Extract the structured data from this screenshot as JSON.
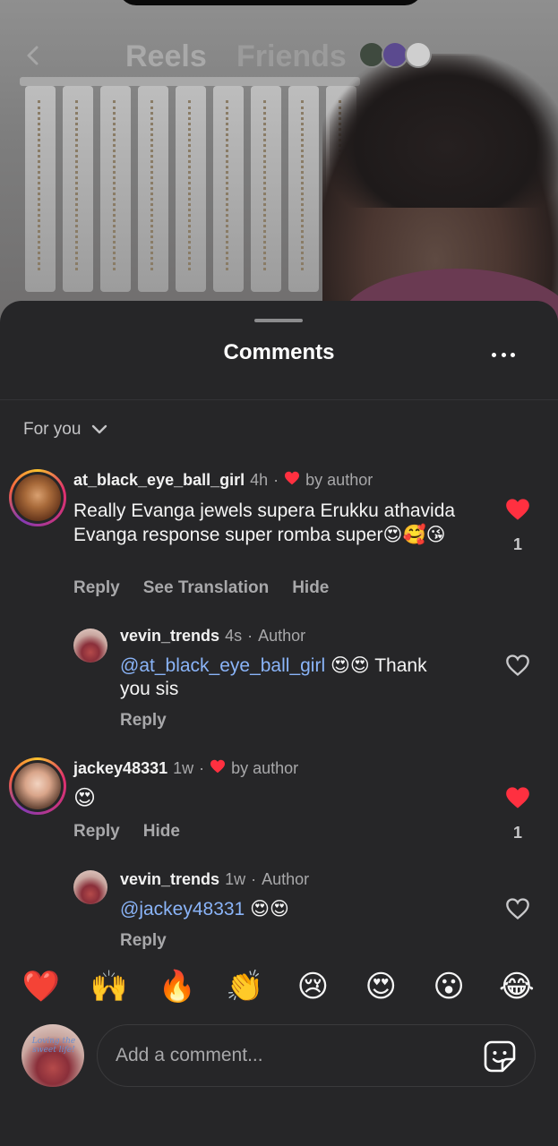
{
  "top_nav": {
    "tab_reels": "Reels",
    "tab_friends": "Friends"
  },
  "sheet": {
    "title": "Comments",
    "filter_label": "For you"
  },
  "comments": [
    {
      "username": "at_black_eye_ball_girl",
      "time": "4h",
      "badge": "by author",
      "text": "Really Evanga jewels supera Erukku athavida Evanga response super romba super",
      "emojis": "😍🥰😘",
      "actions": [
        "Reply",
        "See Translation",
        "Hide"
      ],
      "likes": "1",
      "liked": true,
      "reply": {
        "username": "vevin_trends",
        "time": "4s",
        "role": "Author",
        "mention": "@at_black_eye_ball_girl",
        "emojis": "😍😍",
        "text_after": "Thank",
        "text_line2": "you sis",
        "action": "Reply",
        "liked": false
      }
    },
    {
      "username": "jackey48331",
      "time": "1w",
      "badge": "by author",
      "emojis": "😍",
      "actions": [
        "Reply",
        "Hide"
      ],
      "likes": "1",
      "liked": true,
      "reply": {
        "username": "vevin_trends",
        "time": "1w",
        "role": "Author",
        "mention": "@jackey48331",
        "emojis": "😍😍",
        "action": "Reply",
        "liked": false
      }
    }
  ],
  "emoji_bar": [
    "❤️",
    "🙌",
    "🔥",
    "👏",
    "😢",
    "😍",
    "😮",
    "😂"
  ],
  "composer": {
    "placeholder": "Add a comment...",
    "avatar_text": "Loving the sweet life!"
  },
  "colors": {
    "sheet_bg": "#262628",
    "heart_red": "#ff3040",
    "mention_blue": "#8ab4f8",
    "muted_text": "#a8a8aa"
  }
}
